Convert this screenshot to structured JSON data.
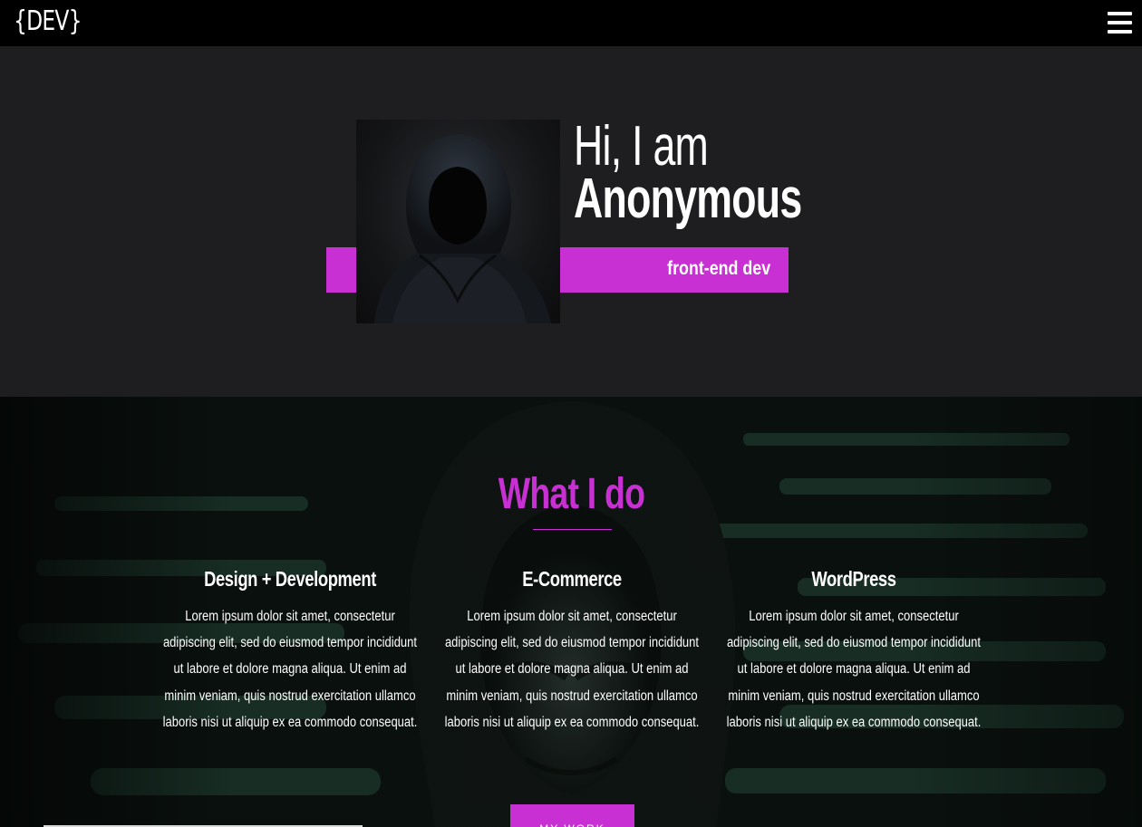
{
  "nav": {
    "logo": "{DEV}",
    "menu_icon": "hamburger-menu-icon"
  },
  "hero": {
    "greeting": "Hi, I am",
    "name": "Anonymous",
    "role": "front-end dev",
    "accent_color": "#c930d3",
    "portrait_icon": "hooded-figure-photo"
  },
  "services": {
    "title": "What I do",
    "items": [
      {
        "title": "Design + Development",
        "text": "Lorem ipsum dolor sit amet, consectetur adipiscing elit, sed do eiusmod tempor incididunt ut labore et dolore magna aliqua. Ut enim ad minim veniam, quis nostrud exercitation ullamco laboris nisi ut aliquip ex ea commodo consequat."
      },
      {
        "title": "E-Commerce",
        "text": "Lorem ipsum dolor sit amet, consectetur adipiscing elit, sed do eiusmod tempor incididunt ut labore et dolore magna aliqua. Ut enim ad minim veniam, quis nostrud exercitation ullamco laboris nisi ut aliquip ex ea commodo consequat."
      },
      {
        "title": "WordPress",
        "text": "Lorem ipsum dolor sit amet, consectetur adipiscing elit, sed do eiusmod tempor incididunt ut labore et dolore magna aliqua. Ut enim ad minim veniam, quis nostrud exercitation ullamco laboris nisi ut aliquip ex ea commodo consequat."
      }
    ],
    "cta_label": "MY WORK"
  },
  "colors": {
    "navbar": "#000000",
    "hero_bg": "#1e1e20",
    "accent": "#c930d3",
    "code_green": "#4fa27e"
  }
}
